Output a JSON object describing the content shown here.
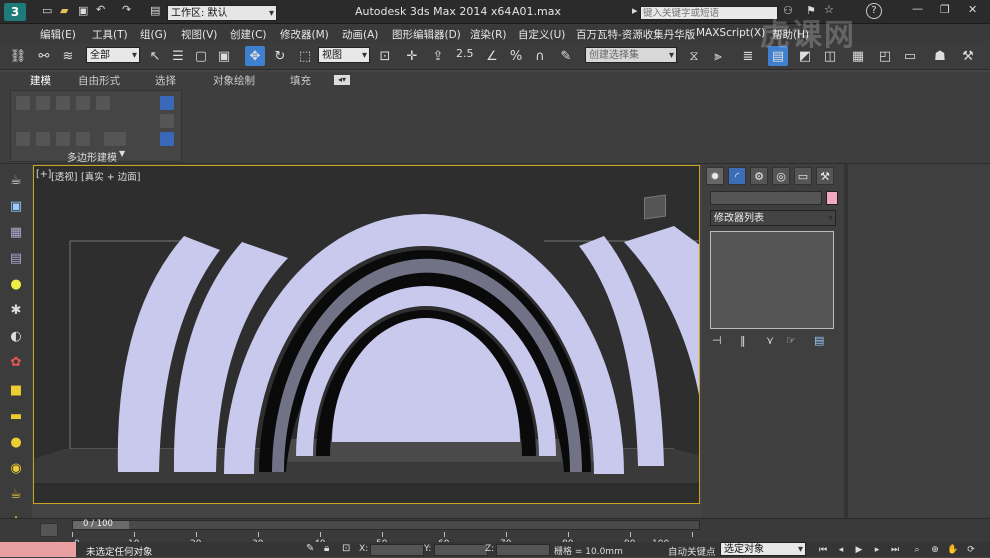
{
  "titlebar": {
    "workspace_label": "工作区: 默认",
    "app_title": "Autodesk 3ds Max  2014 x64",
    "file_name": "A01.max",
    "search_placeholder": "键入关键字或短语"
  },
  "menu": {
    "items": [
      "编辑(E)",
      "工具(T)",
      "组(G)",
      "视图(V)",
      "创建(C)",
      "修改器(M)",
      "动画(A)",
      "图形编辑器(D)",
      "渲染(R)",
      "自定义(U)",
      "百万瓦特-资源收集丹华版",
      "MAXScript(X)",
      "帮助(H)"
    ]
  },
  "toolbar": {
    "selection_filter": "全部",
    "ref_coord": "视图",
    "snap_value": "2.5",
    "named_selection": "创建选择集"
  },
  "ribbon": {
    "tabs": [
      "建模",
      "自由形式",
      "选择",
      "对象绘制",
      "填充"
    ],
    "panel_label": "多边形建模"
  },
  "viewport": {
    "label_plus": "[+]",
    "label_view": "[透视]",
    "label_shading": "[真实 + 边面]"
  },
  "cmdpanel": {
    "modifier_list": "修改器列表",
    "swatch_color": "#f2a7c4"
  },
  "timeline": {
    "frame_counter": "0 / 100",
    "ticks": [
      "0",
      "10",
      "20",
      "30",
      "40",
      "50",
      "60",
      "70",
      "80",
      "90",
      "100"
    ]
  },
  "status": {
    "selection_text": "未选定任何对象",
    "x_label": "X:",
    "y_label": "Y:",
    "z_label": "Z:",
    "grid_text": "栅格 = 10.0mm",
    "autokey_label": "自动关键点",
    "set_key_dropdown": "选定对象"
  },
  "watermark": "虎课网"
}
